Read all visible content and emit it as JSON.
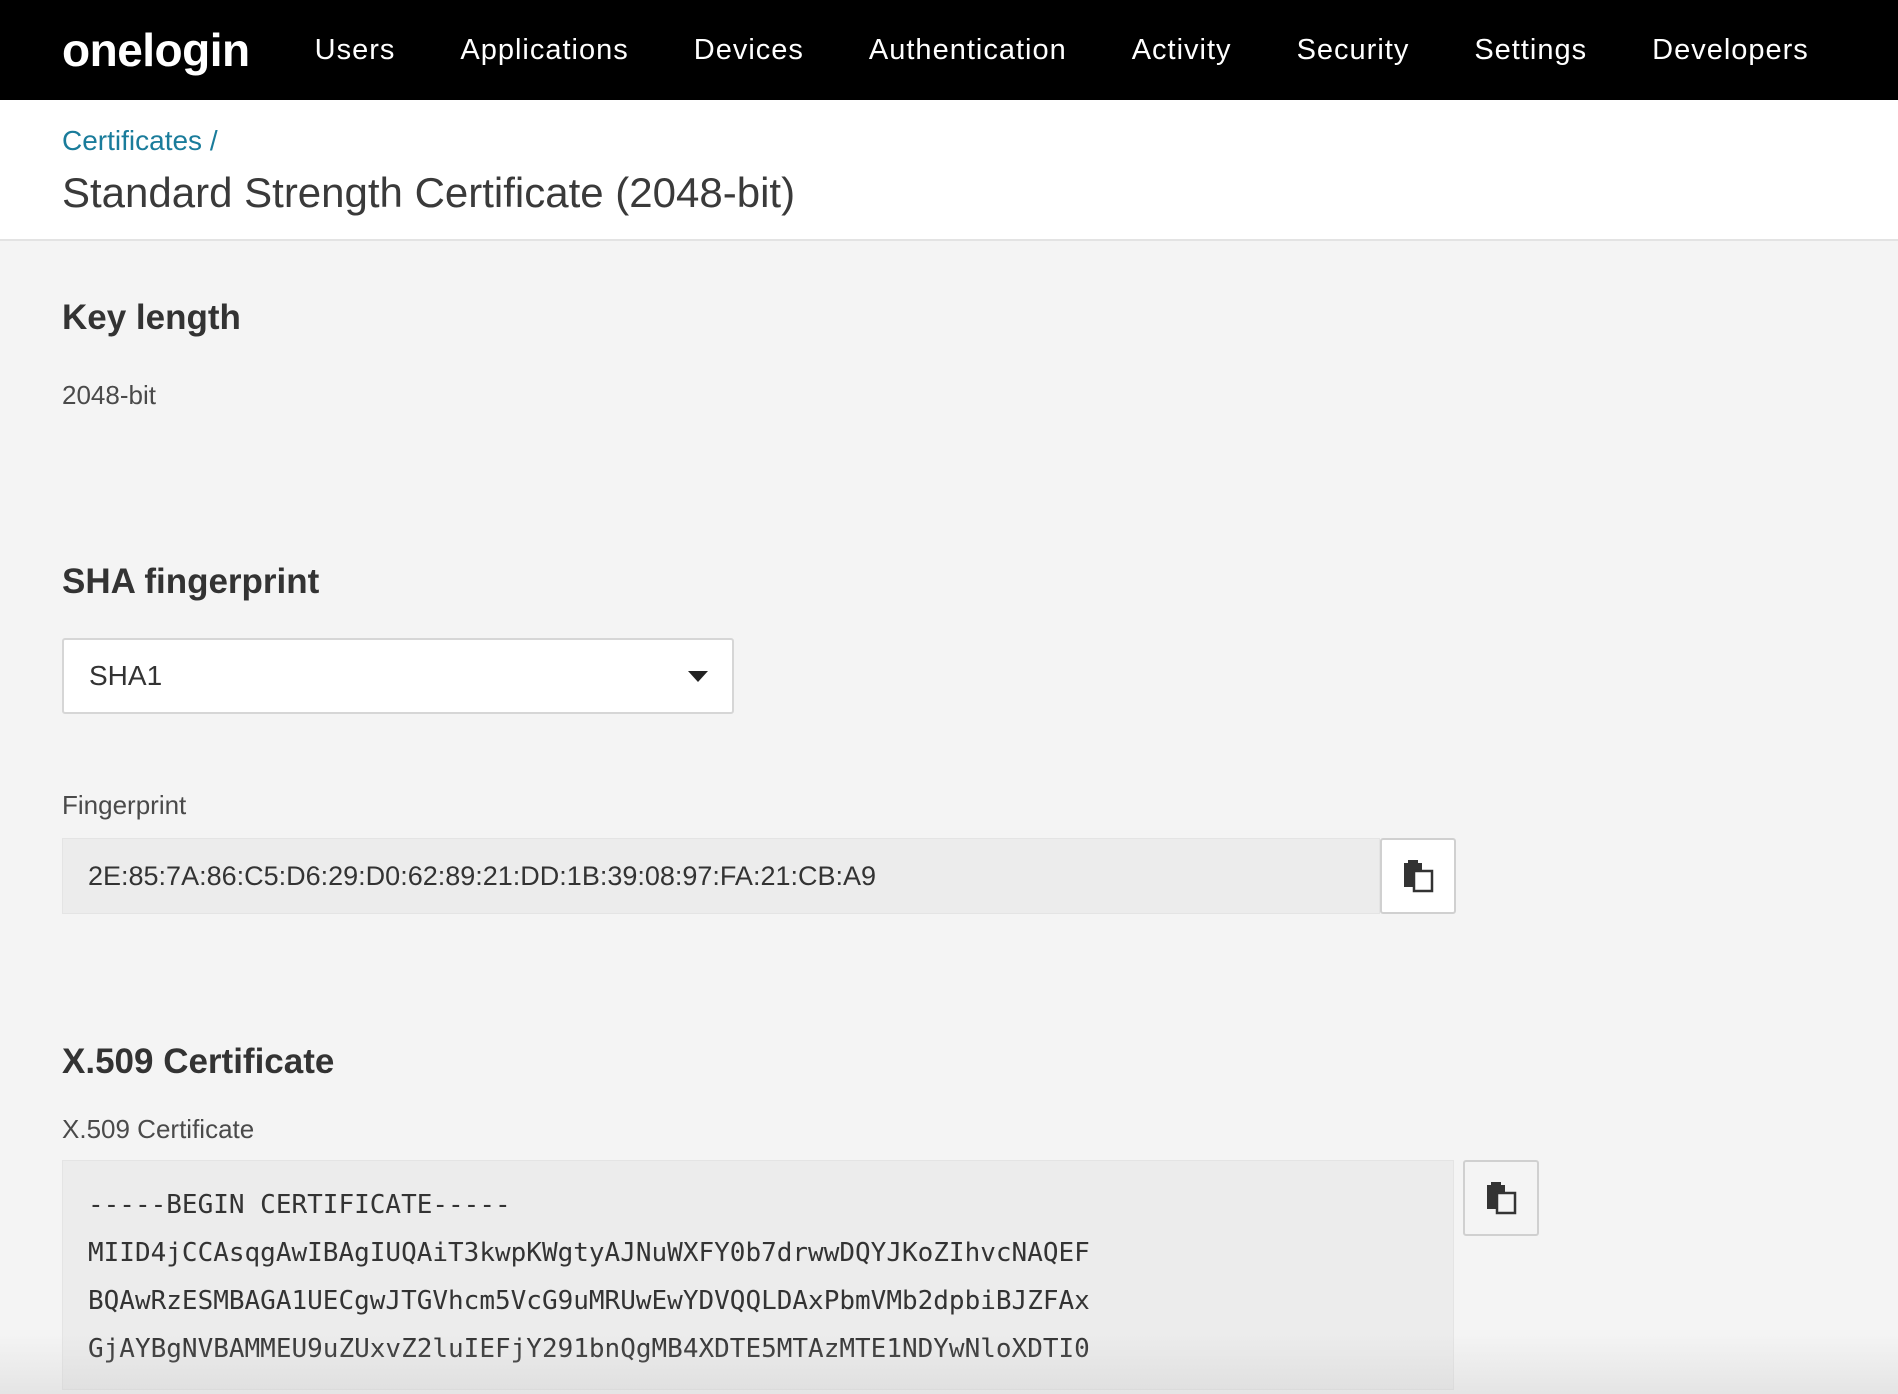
{
  "app": {
    "logo": "onelogin"
  },
  "nav": {
    "items": [
      {
        "label": "Users"
      },
      {
        "label": "Applications"
      },
      {
        "label": "Devices"
      },
      {
        "label": "Authentication"
      },
      {
        "label": "Activity"
      },
      {
        "label": "Security"
      },
      {
        "label": "Settings"
      },
      {
        "label": "Developers"
      }
    ]
  },
  "header": {
    "breadcrumb": "Certificates /",
    "title": "Standard Strength Certificate (2048-bit)"
  },
  "key_length": {
    "heading": "Key length",
    "value": "2048-bit"
  },
  "sha": {
    "heading": "SHA fingerprint",
    "selected": "SHA1",
    "fingerprint_label": "Fingerprint",
    "fingerprint_value": "2E:85:7A:86:C5:D6:29:D0:62:89:21:DD:1B:39:08:97:FA:21:CB:A9"
  },
  "x509": {
    "heading": "X.509 Certificate",
    "label": "X.509 Certificate",
    "lines": [
      "-----BEGIN CERTIFICATE-----",
      "MIID4jCCAsqgAwIBAgIUQAiT3kwpKWgtyAJNuWXFY0b7drwwDQYJKoZIhvcNAQEF",
      "BQAwRzESMBAGA1UECgwJTGVhcm5VcG9uMRUwEwYDVQQLDAxPbmVMb2dpbiBJZFAx",
      "GjAYBgNVBAMMEU9uZUxvZ2luIEFjY291bnQgMB4XDTE5MTAzMTE1NDYwNloXDTI0"
    ]
  },
  "colors": {
    "nav_bg": "#000000",
    "link": "#1a7c9b",
    "page_bg": "#f4f4f4"
  },
  "icons": {
    "copy": "clipboard-copy-icon",
    "dropdown": "caret-down-icon"
  }
}
